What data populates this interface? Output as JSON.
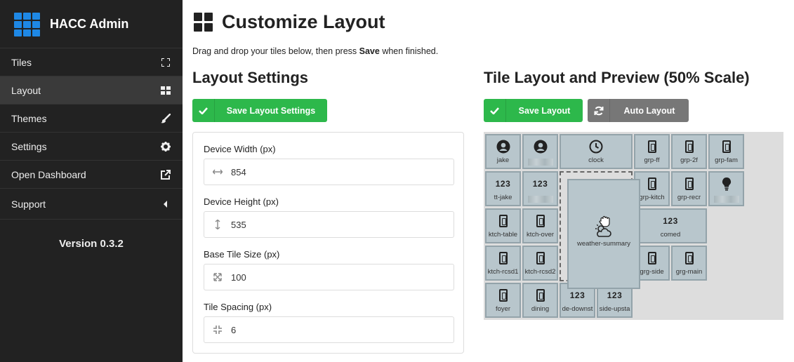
{
  "brand": {
    "title": "HACC Admin"
  },
  "nav": [
    {
      "label": "Tiles",
      "icon": "expand-icon"
    },
    {
      "label": "Layout",
      "icon": "grid-icon",
      "active": true
    },
    {
      "label": "Themes",
      "icon": "brush-icon"
    },
    {
      "label": "Settings",
      "icon": "gear-icon"
    },
    {
      "label": "Open Dashboard",
      "icon": "external-link-icon"
    },
    {
      "label": "Support",
      "icon": "caret-left-icon"
    }
  ],
  "version": "Version 0.3.2",
  "page": {
    "title": "Customize Layout",
    "intro_pre": "Drag and drop your tiles below, then press ",
    "intro_bold": "Save",
    "intro_post": " when finished."
  },
  "layout_settings": {
    "heading": "Layout Settings",
    "save_label": "Save Layout Settings",
    "fields": [
      {
        "label": "Device Width (px)",
        "value": "854",
        "icon": "arrows-horizontal-icon"
      },
      {
        "label": "Device Height (px)",
        "value": "535",
        "icon": "arrows-vertical-icon"
      },
      {
        "label": "Base Tile Size (px)",
        "value": "100",
        "icon": "expand-arrows-icon"
      },
      {
        "label": "Tile Spacing (px)",
        "value": "6",
        "icon": "compress-arrows-icon"
      }
    ]
  },
  "preview": {
    "heading": "Tile Layout and Preview (50% Scale)",
    "save_label": "Save Layout",
    "auto_label": "Auto Layout",
    "tiles": [
      {
        "label": "jake",
        "icon": "person-icon"
      },
      {
        "label": "",
        "icon": "person-icon"
      },
      {
        "label": "clock",
        "icon": "clock-icon"
      },
      {
        "label": "grp-ff",
        "icon": "switch-icon"
      },
      {
        "label": "grp-2f",
        "icon": "switch-icon"
      },
      {
        "label": "grp-fam",
        "icon": "switch-icon"
      },
      {
        "label": "tt-jake",
        "icon": "123"
      },
      {
        "label": "",
        "icon": "123"
      },
      {
        "label": "grp-kitch",
        "icon": "switch-icon"
      },
      {
        "label": "grp-recr",
        "icon": "switch-icon"
      },
      {
        "label": "",
        "icon": "bulb-icon"
      },
      {
        "label": "ktch-table",
        "icon": "switch-icon"
      },
      {
        "label": "ktch-over",
        "icon": "switch-icon"
      },
      {
        "label": "weather-summary",
        "icon": "weather-icon"
      },
      {
        "label": "comed",
        "icon": "123"
      },
      {
        "label": "ktch-rcsd1",
        "icon": "switch-icon"
      },
      {
        "label": "ktch-rcsd2",
        "icon": "switch-icon"
      },
      {
        "label": "grg-side",
        "icon": "switch-icon"
      },
      {
        "label": "grg-main",
        "icon": "switch-icon"
      },
      {
        "label": "foyer",
        "icon": "switch-icon"
      },
      {
        "label": "dining",
        "icon": "switch-icon"
      },
      {
        "label": "de-downst",
        "icon": "123"
      },
      {
        "label": "side-upsta",
        "icon": "123"
      }
    ]
  },
  "colors": {
    "accent": "#1e88e5",
    "success": "#2db84b",
    "secondary": "#777777",
    "sidebar": "#222222"
  }
}
